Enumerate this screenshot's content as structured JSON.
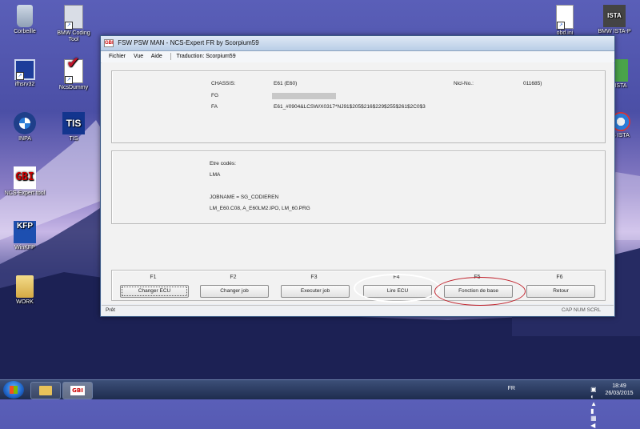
{
  "desktop_icons": [
    {
      "id": "recycle-bin",
      "label": "Corbeille"
    },
    {
      "id": "bmw-coding-tool",
      "label": "BMW Coding Tool"
    },
    {
      "id": "ifhsrv32",
      "label": "ifhsrv32"
    },
    {
      "id": "ncsdummy",
      "label": "NcsDummy"
    },
    {
      "id": "inpa",
      "label": "INPA"
    },
    {
      "id": "tis",
      "label": "TIS"
    },
    {
      "id": "ncs-expert-tool",
      "label": "NCS-Expert tool"
    },
    {
      "id": "winkfp",
      "label": "WinKFP"
    },
    {
      "id": "work",
      "label": "WORK"
    },
    {
      "id": "obd-ini",
      "label": "obd.ini"
    },
    {
      "id": "bmw-ista-p",
      "label": "BMW ISTA-P"
    },
    {
      "id": "ista",
      "label": "ISTA"
    },
    {
      "id": "s-ista",
      "label": "S ISTA"
    }
  ],
  "window": {
    "title": "FSW PSW MAN - NCS-Expert FR by Scorpium59",
    "icon_text": "GBI",
    "menu": [
      "Fichier",
      "Vue",
      "Aide"
    ],
    "translation": "Traduction: Scorpium59"
  },
  "info": {
    "chassis_label": "CHASSIS:",
    "chassis_value": "E61 (E60)",
    "nicl_label": "Nicl-No.:",
    "nicl_value": "011685)",
    "fg_label": "FG",
    "fa_label": "FA",
    "fa_value": "E61_#0904&LCSW/X0317*NJ91$205$216$229$255$261$2C0$3"
  },
  "coding": {
    "line1": "Etre codés:",
    "line2": "LMA",
    "line3": "JOBNAME = SG_CODIEREN",
    "line4": "LM_E60.C08, A_E60LM2.IPO, LM_60.PRG"
  },
  "function_keys": [
    {
      "key": "F1",
      "label": "Changer ECU"
    },
    {
      "key": "F2",
      "label": "Changer job"
    },
    {
      "key": "F3",
      "label": "Executer job"
    },
    {
      "key": "F4",
      "label": "Lire ECU"
    },
    {
      "key": "F5",
      "label": "Fonction de base"
    },
    {
      "key": "F6",
      "label": "Retour"
    }
  ],
  "status": {
    "left": "Prêt",
    "right": "CAP  NUM  SCRL"
  },
  "annotations": {
    "white_circle_color": "#ffffff",
    "red_circle_color": "#c0202a"
  },
  "taskbar": {
    "language": "FR",
    "time": "18:49",
    "date": "26/03/2015"
  }
}
